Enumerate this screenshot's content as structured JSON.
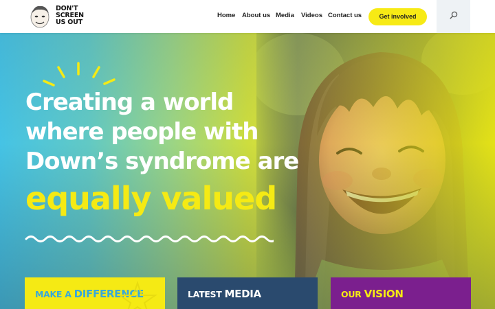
{
  "header": {
    "logo": {
      "line1": "DON'T",
      "line2": "SCREEN",
      "line3": "US OUT"
    },
    "nav": [
      {
        "label": "Home"
      },
      {
        "label": "About us"
      },
      {
        "label": "Media"
      },
      {
        "label": "Videos"
      },
      {
        "label": "Contact us"
      }
    ],
    "cta_label": "Get involved",
    "search_icon": "search-icon"
  },
  "hero": {
    "headline": [
      "Creating a world",
      "where people with",
      "Down’s syndrome are"
    ],
    "headline_accent": "equally valued",
    "colors": {
      "accent": "#f5ea14",
      "text": "#ffffff"
    }
  },
  "cards": [
    {
      "prefix": "MAKE A ",
      "emphasis": "DIFFERENCE",
      "bg": "#f5ea14"
    },
    {
      "prefix": "LATEST ",
      "emphasis": "MEDIA",
      "bg": "#2a4a6e"
    },
    {
      "prefix": "OUR ",
      "emphasis": "VISION",
      "bg": "#7b1f8e"
    }
  ]
}
